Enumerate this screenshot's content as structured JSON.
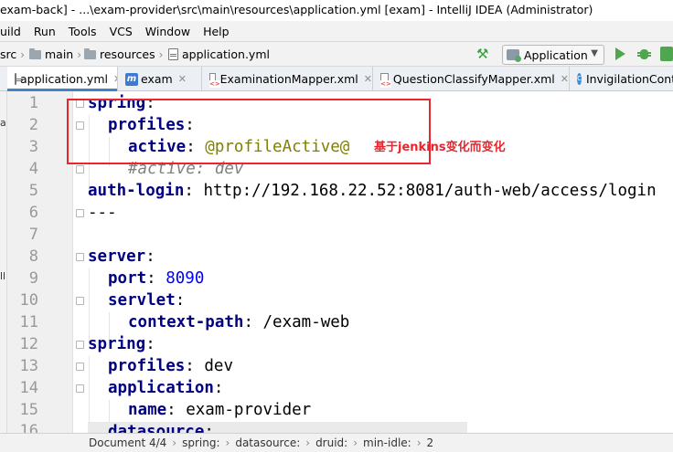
{
  "window": {
    "title": "exam-back] - ...\\exam-provider\\src\\main\\resources\\application.yml [exam] - IntelliJ IDEA (Administrator)"
  },
  "menu": [
    "Build",
    "Run",
    "Tools",
    "VCS",
    "Window",
    "Help"
  ],
  "menu_display": [
    "uild",
    "Run",
    "Tools",
    "VCS",
    "Window",
    "Help"
  ],
  "nav": {
    "crumbs": [
      "src",
      "main",
      "resources",
      "application.yml"
    ],
    "run_config": "Application"
  },
  "tabs": [
    {
      "label": "application.yml",
      "active": true
    },
    {
      "label": "exam",
      "active": false
    },
    {
      "label": "ExaminationMapper.xml",
      "active": false
    },
    {
      "label": "QuestionClassifyMapper.xml",
      "active": false
    },
    {
      "label": "InvigilationCont",
      "active": false
    }
  ],
  "left_strip_labels": [
    "a",
    "ll"
  ],
  "editor": {
    "lines": [
      {
        "n": "1",
        "key": "spring",
        "value": ""
      },
      {
        "n": "2",
        "key": "profiles",
        "value": ""
      },
      {
        "n": "3",
        "key": "active",
        "value": "@profileActive@"
      },
      {
        "n": "4",
        "comment": "#active: dev"
      },
      {
        "n": "5",
        "key": "auth-login",
        "value": "http://192.168.22.52:8081/auth-web/access/login"
      },
      {
        "n": "6",
        "text": "---"
      },
      {
        "n": "7",
        "text": ""
      },
      {
        "n": "8",
        "key": "server",
        "value": ""
      },
      {
        "n": "9",
        "key": "port",
        "value": "8090"
      },
      {
        "n": "10",
        "key": "servlet",
        "value": ""
      },
      {
        "n": "11",
        "key": "context-path",
        "value": "/exam-web"
      },
      {
        "n": "12",
        "key": "spring",
        "value": ""
      },
      {
        "n": "13",
        "key": "profiles",
        "value": "dev"
      },
      {
        "n": "14",
        "key": "application",
        "value": ""
      },
      {
        "n": "15",
        "key": "name",
        "value": "exam-provider"
      },
      {
        "n": "16",
        "key": "datasource",
        "value": ""
      }
    ],
    "annotation": "基于jenkins变化而变化"
  },
  "status_breadcrumb": [
    "Document 4/4",
    "spring:",
    "datasource:",
    "druid:",
    "min-idle:",
    "2"
  ]
}
